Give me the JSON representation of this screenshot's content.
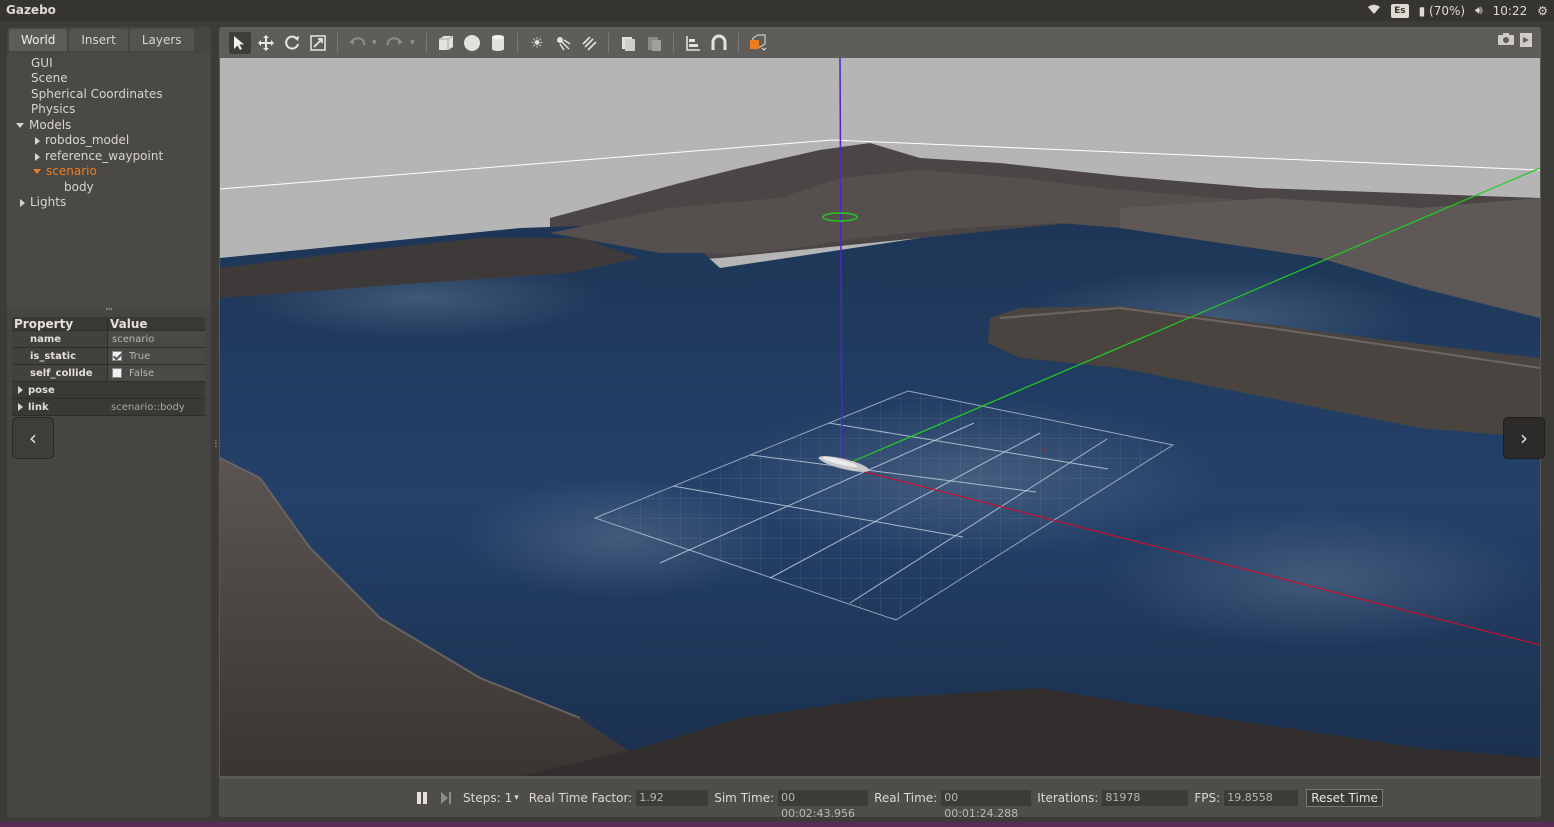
{
  "topbar": {
    "title": "Gazebo",
    "keyboard": "Es",
    "battery": "(70%)",
    "clock": "10:22"
  },
  "left_panel": {
    "tabs": [
      "World",
      "Insert",
      "Layers"
    ],
    "active_tab": "World",
    "tree": {
      "gui": "GUI",
      "scene": "Scene",
      "spherical": "Spherical Coordinates",
      "physics": "Physics",
      "models": "Models",
      "model_1": "robdos_model",
      "model_2": "reference_waypoint",
      "model_3": "scenario",
      "model_3_child": "body",
      "lights": "Lights"
    },
    "properties": {
      "header_property": "Property",
      "header_value": "Value",
      "name_key": "name",
      "name_value": "scenario",
      "is_static_key": "is_static",
      "is_static_value": "True",
      "is_static_checked": true,
      "self_collide_key": "self_collide",
      "self_collide_value": "False",
      "self_collide_checked": false,
      "pose_key": "pose",
      "link_key": "link",
      "link_value": "scenario::body"
    },
    "collapse_icon": "‹"
  },
  "toolbar": {
    "icons": [
      "select-arrow-icon",
      "translate-icon",
      "rotate-icon",
      "scale-icon",
      "undo-icon",
      "redo-icon",
      "box-icon",
      "sphere-icon",
      "cylinder-icon",
      "point-light-icon",
      "spot-light-icon",
      "directional-light-icon",
      "copy-icon",
      "paste-icon",
      "align-icon",
      "snap-icon",
      "view-angle-icon",
      "screenshot-icon",
      "record-icon"
    ]
  },
  "viewport": {
    "expand_icon": "›"
  },
  "status": {
    "steps_label": "Steps:",
    "steps_value": "1",
    "rtf_label": "Real Time Factor:",
    "rtf_value": "1.92",
    "sim_time_label": "Sim Time:",
    "sim_time_value": "00 00:02:43.956",
    "real_time_label": "Real Time:",
    "real_time_value": "00 00:01:24.288",
    "iterations_label": "Iterations:",
    "iterations_value": "81978",
    "fps_label": "FPS:",
    "fps_value": "19.8558",
    "reset_label": "Reset Time"
  },
  "colors": {
    "selected": "#f07c1e",
    "axis_x": "#c8102e",
    "axis_y": "#22cc22",
    "axis_z": "#5522cc",
    "water": "#1f3a5c",
    "terrain": "#55504d",
    "sky": "#b8b8b8"
  }
}
